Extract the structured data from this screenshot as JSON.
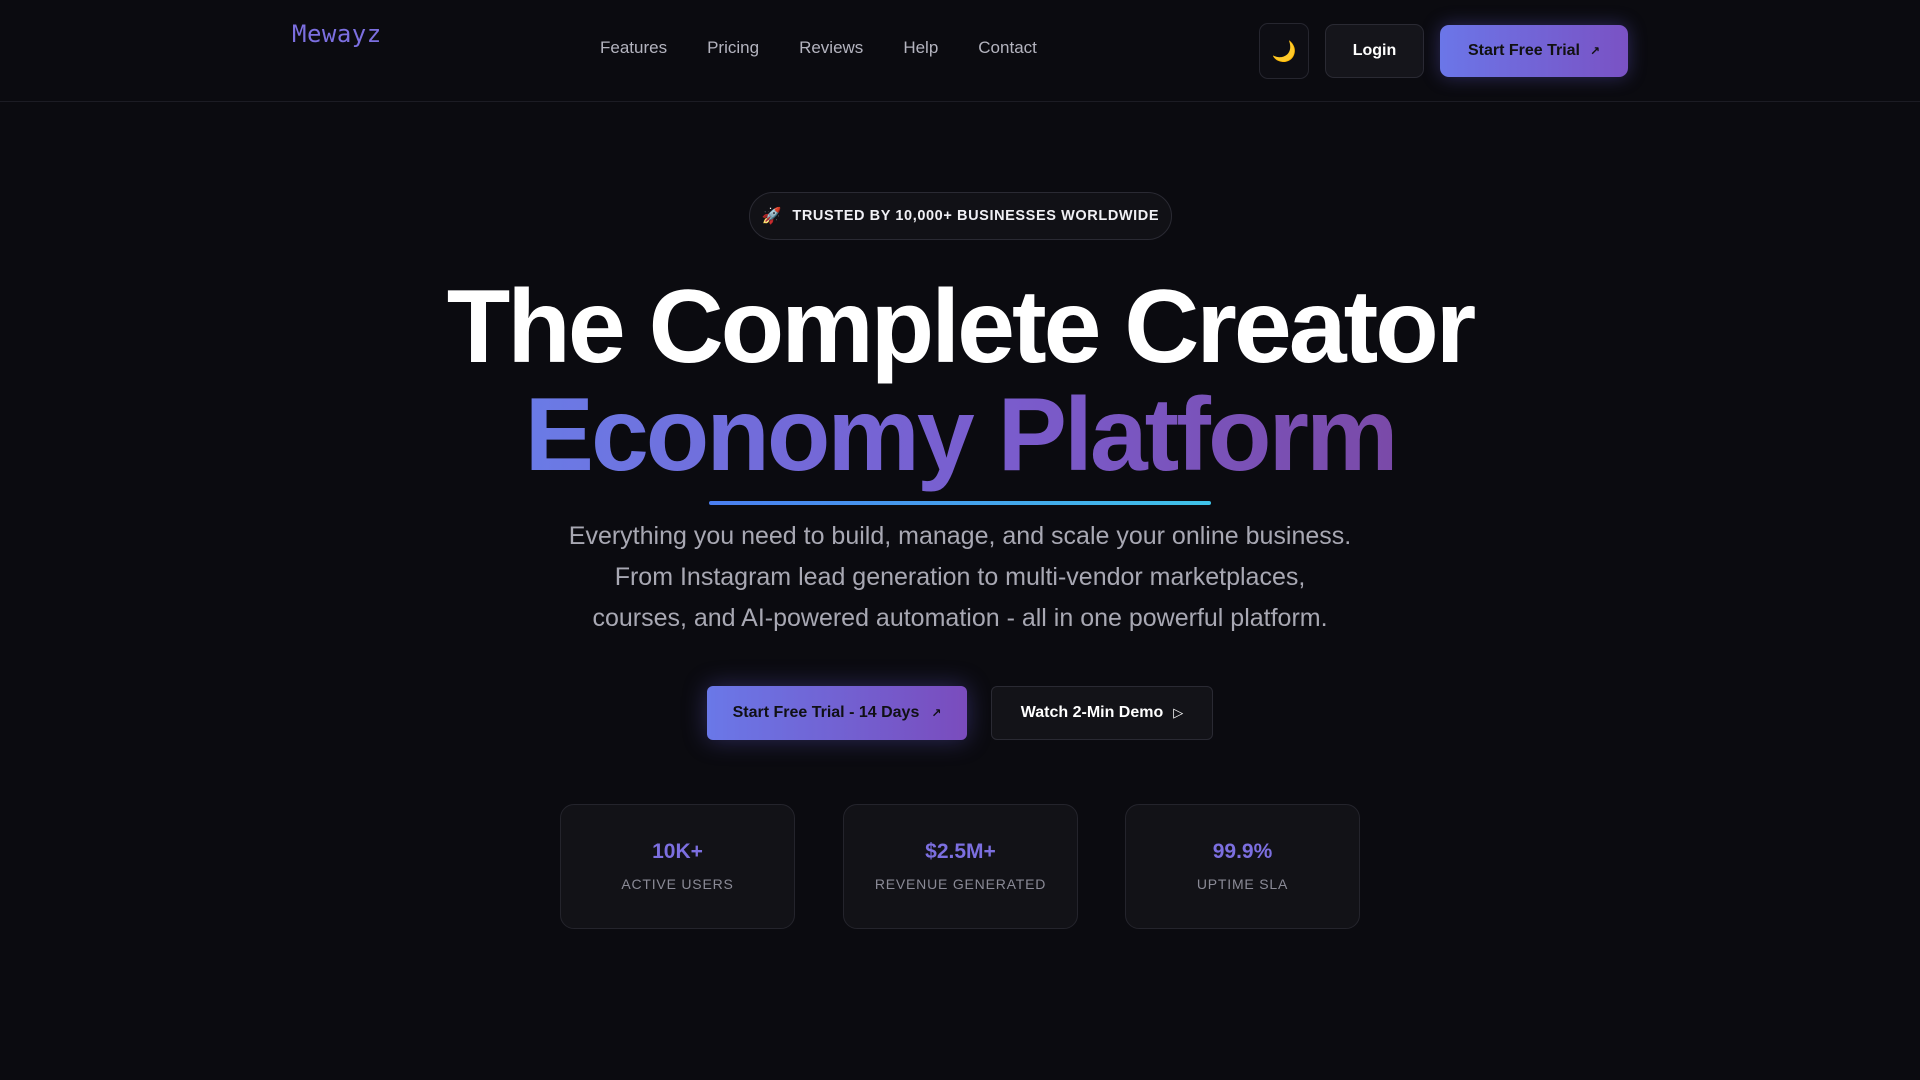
{
  "header": {
    "logo": "Mewayz",
    "nav": [
      "Features",
      "Pricing",
      "Reviews",
      "Help",
      "Contact"
    ],
    "theme_toggle_icon": "moon-icon",
    "login_label": "Login",
    "trial_label": "Start Free Trial",
    "trial_arrow": "↗"
  },
  "hero": {
    "badge_icon": "rocket-icon",
    "badge_emoji": "🚀",
    "badge_text": "TRUSTED BY 10,000+ BUSINESSES WORLDWIDE",
    "headline_line1": "The Complete Creator",
    "headline_line2": "Economy Platform",
    "subtitle_line1": "Everything you need to build, manage, and scale your online business.",
    "subtitle_line2": "From Instagram lead generation to multi-vendor marketplaces,",
    "subtitle_line3": "courses, and AI-powered automation - all in one powerful platform.",
    "cta_primary": "Start Free Trial - 14 Days",
    "cta_primary_arrow": "↗",
    "cta_secondary": "Watch 2-Min Demo",
    "cta_secondary_icon": "▷"
  },
  "stats": [
    {
      "value": "10K+",
      "label": "ACTIVE USERS"
    },
    {
      "value": "$2.5M+",
      "label": "REVENUE GENERATED"
    },
    {
      "value": "99.9%",
      "label": "UPTIME SLA"
    }
  ],
  "colors": {
    "background": "#0b0b10",
    "accent": "#7c6fe0",
    "gradient_start": "#6a7be6",
    "gradient_end": "#7a4aa8",
    "underline_start": "#4a7ef0",
    "underline_end": "#3fc3e8"
  }
}
